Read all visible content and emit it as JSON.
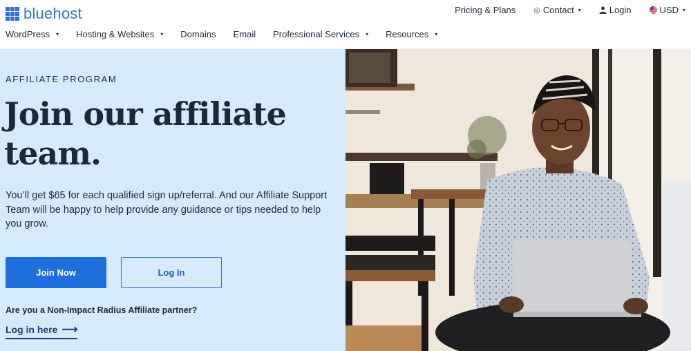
{
  "brand": {
    "name": "bluehost",
    "color": "#2f6fd6"
  },
  "topnav": {
    "pricing": "Pricing & Plans",
    "contact": "Contact",
    "login": "Login",
    "currency": "USD"
  },
  "mainnav": {
    "items": [
      "WordPress",
      "Hosting & Websites",
      "Domains",
      "Email",
      "Professional Services",
      "Resources"
    ]
  },
  "hero": {
    "eyebrow": "AFFILIATE PROGRAM",
    "headline_line1": "Join our affiliate",
    "headline_line2": "team.",
    "body": "You’ll get $65 for each qualified sign up/referral. And our Affiliate Support Team will be happy to help provide any guidance or tips needed to help you grow.",
    "join_label": "Join Now",
    "login_label": "Log In",
    "partner_question": "Are you a Non-Impact Radius Affiliate partner?",
    "partner_link": "Log in here"
  },
  "colors": {
    "hero_bg": "#d5eafb",
    "primary": "#1e6fdd",
    "text": "#1b2a3a"
  }
}
